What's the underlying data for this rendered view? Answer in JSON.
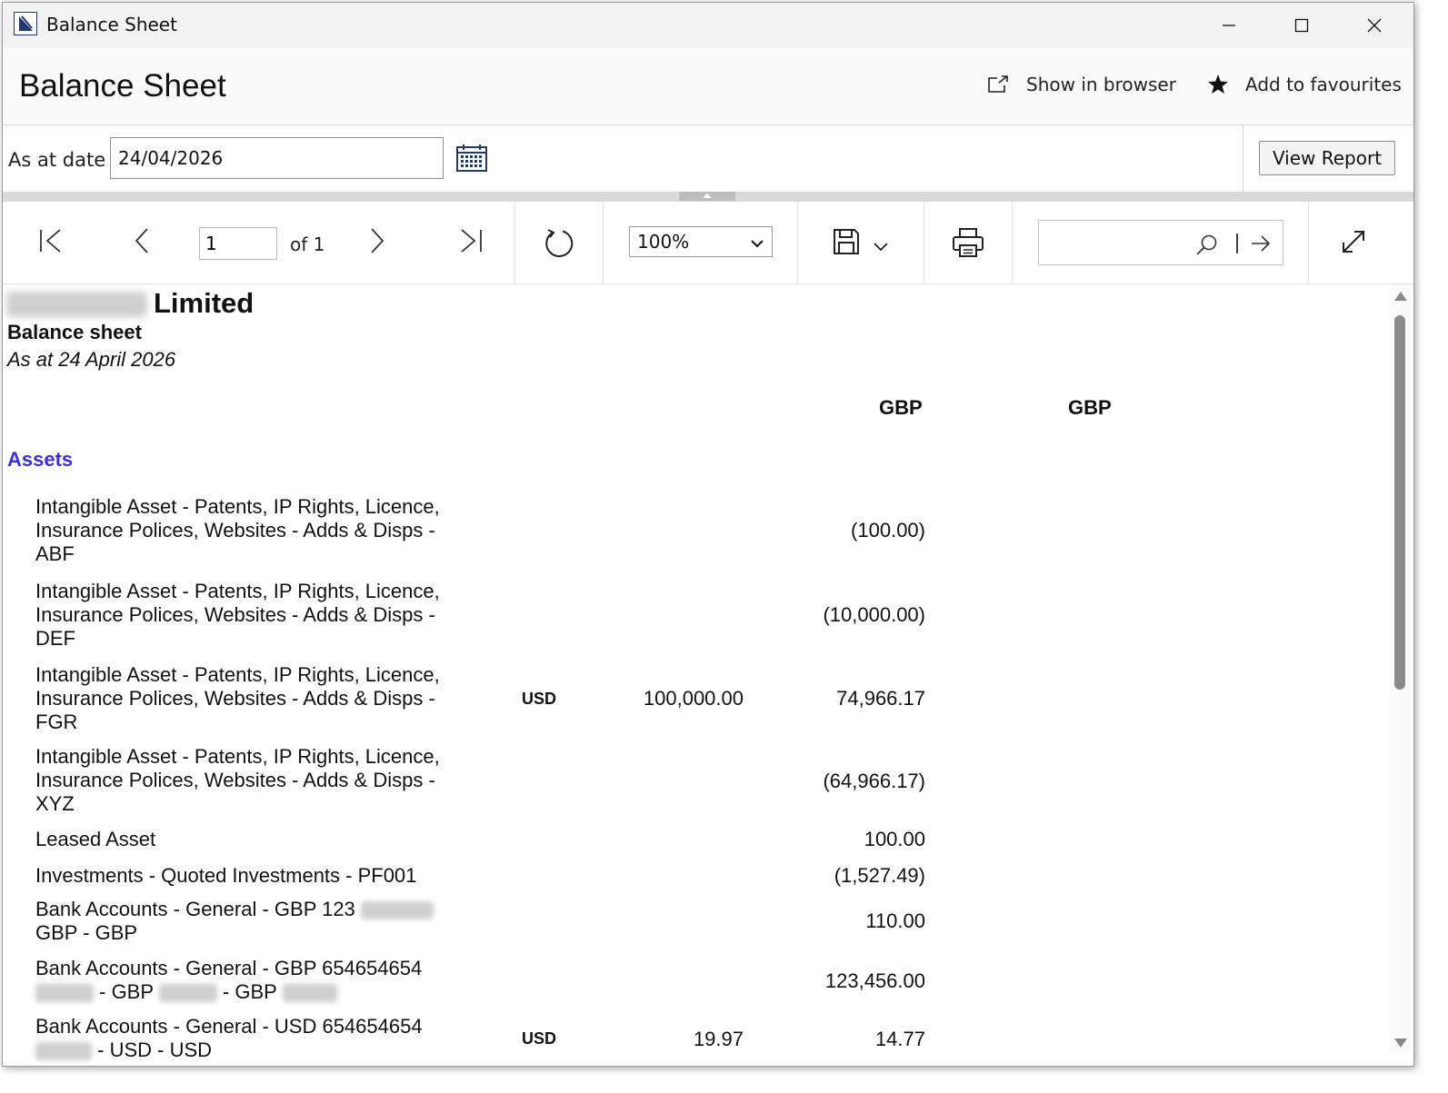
{
  "window": {
    "title": "Balance Sheet"
  },
  "header": {
    "title": "Balance Sheet",
    "show_in_browser": "Show in browser",
    "add_to_favourites": "Add to favourites"
  },
  "params": {
    "as_at_label": "As at date",
    "as_at_value": "24/04/2026",
    "view_report": "View Report"
  },
  "toolbar": {
    "page_current": "1",
    "page_of": "of 1",
    "zoom": "100%",
    "search_value": ""
  },
  "report": {
    "company_suffix": "Limited",
    "subtitle": "Balance sheet",
    "date_line": "As at 24 April 2026",
    "col1": "GBP",
    "col2": "GBP",
    "section": "Assets",
    "rows": [
      {
        "account": "Intangible Asset - Patents, IP Rights, Licence, Insurance Polices, Websites - Adds & Disps - ABF",
        "currency": "",
        "foreign": "",
        "gbp": "(100.00)"
      },
      {
        "account": "Intangible Asset - Patents, IP Rights, Licence, Insurance Polices, Websites - Adds & Disps - DEF",
        "currency": "",
        "foreign": "",
        "gbp": "(10,000.00)"
      },
      {
        "account": "Intangible Asset - Patents, IP Rights, Licence, Insurance Polices, Websites - Adds & Disps - FGR",
        "currency": "USD",
        "foreign": "100,000.00",
        "gbp": "74,966.17"
      },
      {
        "account": "Intangible Asset - Patents, IP Rights, Licence, Insurance Polices, Websites - Adds & Disps - XYZ",
        "currency": "",
        "foreign": "",
        "gbp": "(64,966.17)"
      },
      {
        "account": "Leased Asset",
        "currency": "",
        "foreign": "",
        "gbp": "100.00"
      },
      {
        "account": "Investments - Quoted Investments - PF001",
        "currency": "",
        "foreign": "",
        "gbp": "(1,527.49)"
      },
      {
        "account_a": "Bank Accounts - General - GBP 123",
        "account_b": "GBP - GBP",
        "currency": "",
        "foreign": "",
        "gbp": "110.00"
      },
      {
        "account_a": "Bank Accounts - General - GBP 654654654",
        "account_b1": "- GBP",
        "account_b2": "- GBP",
        "currency": "",
        "foreign": "",
        "gbp": "123,456.00"
      },
      {
        "account_a": "Bank Accounts - General - USD 654654654",
        "account_b": "- USD - USD",
        "currency": "USD",
        "foreign": "19.97",
        "gbp": "14.77"
      }
    ]
  },
  "colors": {
    "section": "#3a2fdc"
  }
}
